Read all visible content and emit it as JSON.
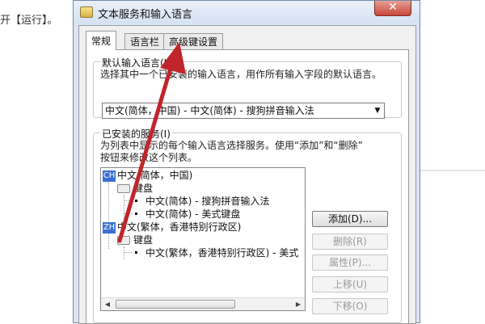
{
  "background": {
    "text": "开【运行】。"
  },
  "dialog": {
    "title": "文本服务和输入语言",
    "close_glyph": "✕",
    "tabs": [
      {
        "label": "常规",
        "active": true
      },
      {
        "label": "语言栏",
        "active": false
      },
      {
        "label": "高级键设置",
        "active": false
      }
    ],
    "default_language": {
      "title": "默认输入语言(L)",
      "description": "选择其中一个已安装的输入语言，用作所有输入字段的默认语言。",
      "selected": "中文(简体，中国) - 中文(简体) - 搜狗拼音输入法"
    },
    "installed_services": {
      "title": "已安装的服务(I)",
      "description_line1": "为列表中显示的每个输入语言选择服务。使用“添加”和“删除”",
      "description_line2": "按钮来修改这个列表。",
      "tree": [
        {
          "badge": "CH",
          "label": "中文(简体，中国)"
        },
        {
          "label": "键盘"
        },
        {
          "label": "中文(简体) - 搜狗拼音输入法"
        },
        {
          "label": "中文(简体) - 美式键盘"
        },
        {
          "badge": "ZH",
          "label": "中文(繁体，香港特别行政区)"
        },
        {
          "label": "键盘"
        },
        {
          "label": "中文(繁体，香港特别行政区) - 美式"
        }
      ],
      "buttons": [
        {
          "label": "添加(D)...",
          "enabled": true
        },
        {
          "label": "删除(R)",
          "enabled": false
        },
        {
          "label": "属性(P)...",
          "enabled": false
        },
        {
          "label": "上移(U)",
          "enabled": false
        },
        {
          "label": "下移(O)",
          "enabled": false
        }
      ]
    }
  },
  "annotation": {
    "arrow_color": "#c0252b"
  }
}
